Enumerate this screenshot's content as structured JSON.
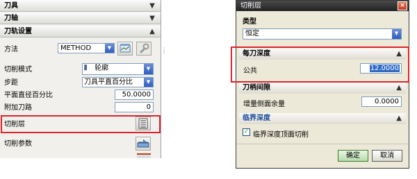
{
  "left_panel": {
    "sections": {
      "tool": "刀具",
      "axis": "刀轴",
      "path_settings": "刀轨设置"
    },
    "rows": {
      "method_label": "方法",
      "method_value": "METHOD",
      "cut_mode_label": "切削模式",
      "cut_mode_value": "轮廓",
      "stepover_label": "步距",
      "stepover_value": "刀具平直百分比",
      "flat_pct_label": "平面直径百分比",
      "flat_pct_value": "50.0000",
      "extra_paths_label": "附加刀路",
      "extra_paths_value": "0",
      "cut_levels_label": "切削层",
      "cut_params_label": "切削参数"
    }
  },
  "dialog": {
    "title": "切削层",
    "close_glyph": "×",
    "type_label": "类型",
    "type_value": "恒定",
    "depth_section": "每刀深度",
    "common_label": "公共",
    "common_value": "12.0000",
    "range_section": "刀柄间隙",
    "stock_label": "增量侧面余量",
    "stock_value": "0.0000",
    "critical_section": "临界深度",
    "critical_checkbox": "临界深度顶面切削",
    "ok": "确定",
    "cancel": "取消"
  }
}
